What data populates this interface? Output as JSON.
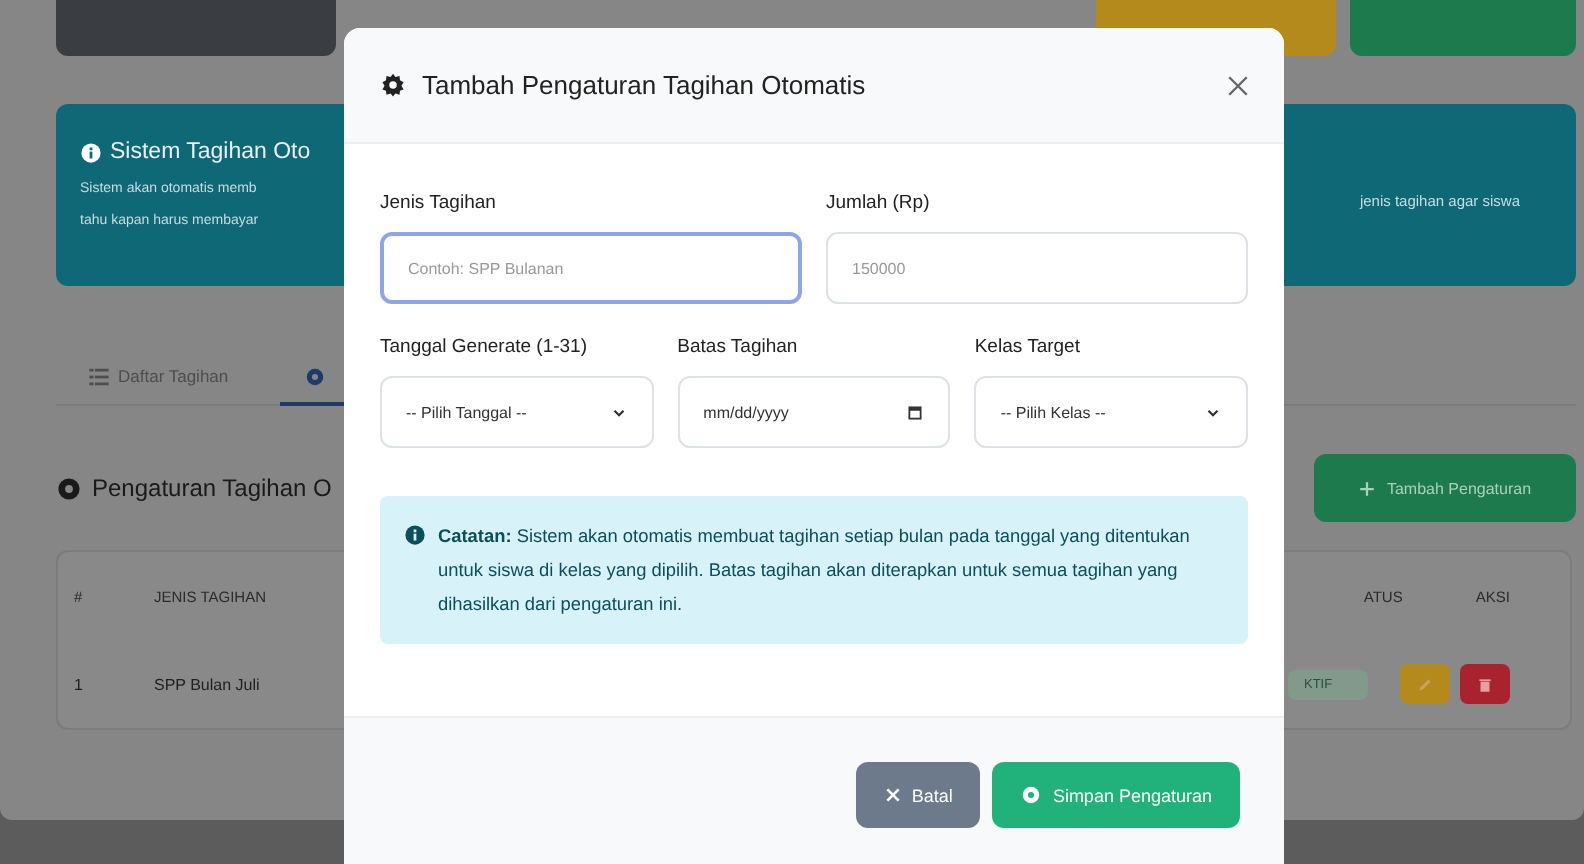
{
  "page": {
    "alert": {
      "title": "Sistem Tagihan Oto",
      "lines_left": [
        "Sistem akan otomatis memb",
        "tahu kapan harus membayar"
      ],
      "line_right": "jenis tagihan agar siswa"
    },
    "tabs": [
      {
        "label": "Daftar Tagihan",
        "selected": false
      },
      {
        "selected": true
      }
    ],
    "section_title": "Pengaturan Tagihan O",
    "add_button": "Tambah Pengaturan",
    "table": {
      "columns_left": [
        "#",
        "JENIS TAGIHAN"
      ],
      "columns_right": [
        "ATUS",
        "AKSI"
      ],
      "rows": [
        {
          "number": "1",
          "name": "SPP Bulan Juli",
          "status": "KTIF"
        }
      ]
    }
  },
  "modal": {
    "title": "Tambah Pengaturan Tagihan Otomatis",
    "rows": [
      [
        {
          "kind": "text",
          "label": "Jenis Tagihan",
          "placeholder": "Contoh: SPP Bulanan",
          "focused": true
        },
        {
          "kind": "text",
          "label": "Jumlah (Rp)",
          "placeholder": "150000",
          "focused": false
        }
      ],
      [
        {
          "kind": "select",
          "label": "Tanggal Generate (1-31)",
          "value": "-- Pilih Tanggal --"
        },
        {
          "kind": "date",
          "label": "Batas Tagihan",
          "value": "mm/dd/yyyy"
        },
        {
          "kind": "select",
          "label": "Kelas Target",
          "value": "-- Pilih Kelas --"
        }
      ]
    ],
    "note": "**Catatan:** Sistem akan otomatis membuat tagihan setiap bulan pada tanggal yang ditentukan untuk siswa di kelas yang dipilih. Batas tagihan akan diterapkan untuk semua tagihan yang dihasilkan dari pengaturan ini.",
    "buttons": [
      {
        "kind": "cancel",
        "label": "Batal"
      },
      {
        "kind": "save",
        "label": "Simpan Pengaturan"
      }
    ]
  }
}
